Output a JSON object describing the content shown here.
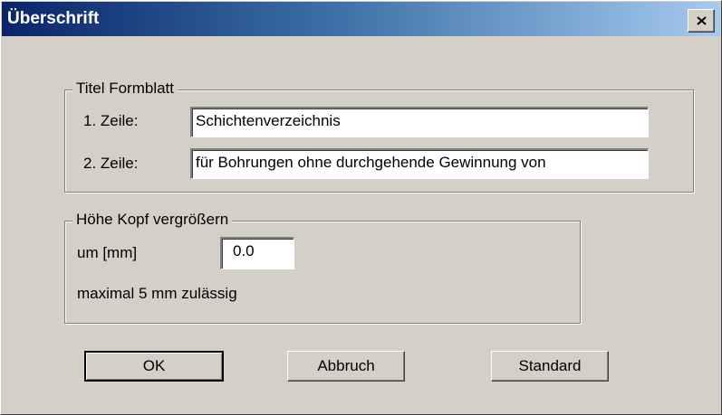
{
  "window": {
    "title": "Überschrift",
    "close_icon": "close-icon"
  },
  "title_group": {
    "legend": "Titel Formblatt",
    "line1_label": "1. Zeile:",
    "line1_value": "Schichtenverzeichnis",
    "line2_label": "2. Zeile:",
    "line2_value": "für Bohrungen ohne durchgehende Gewinnung von"
  },
  "head_group": {
    "legend": "Höhe Kopf vergrößern",
    "amount_label": "um [mm]",
    "amount_value": "0.0",
    "hint": "maximal 5 mm zulässig"
  },
  "buttons": {
    "ok": "OK",
    "cancel": "Abbruch",
    "default": "Standard"
  }
}
